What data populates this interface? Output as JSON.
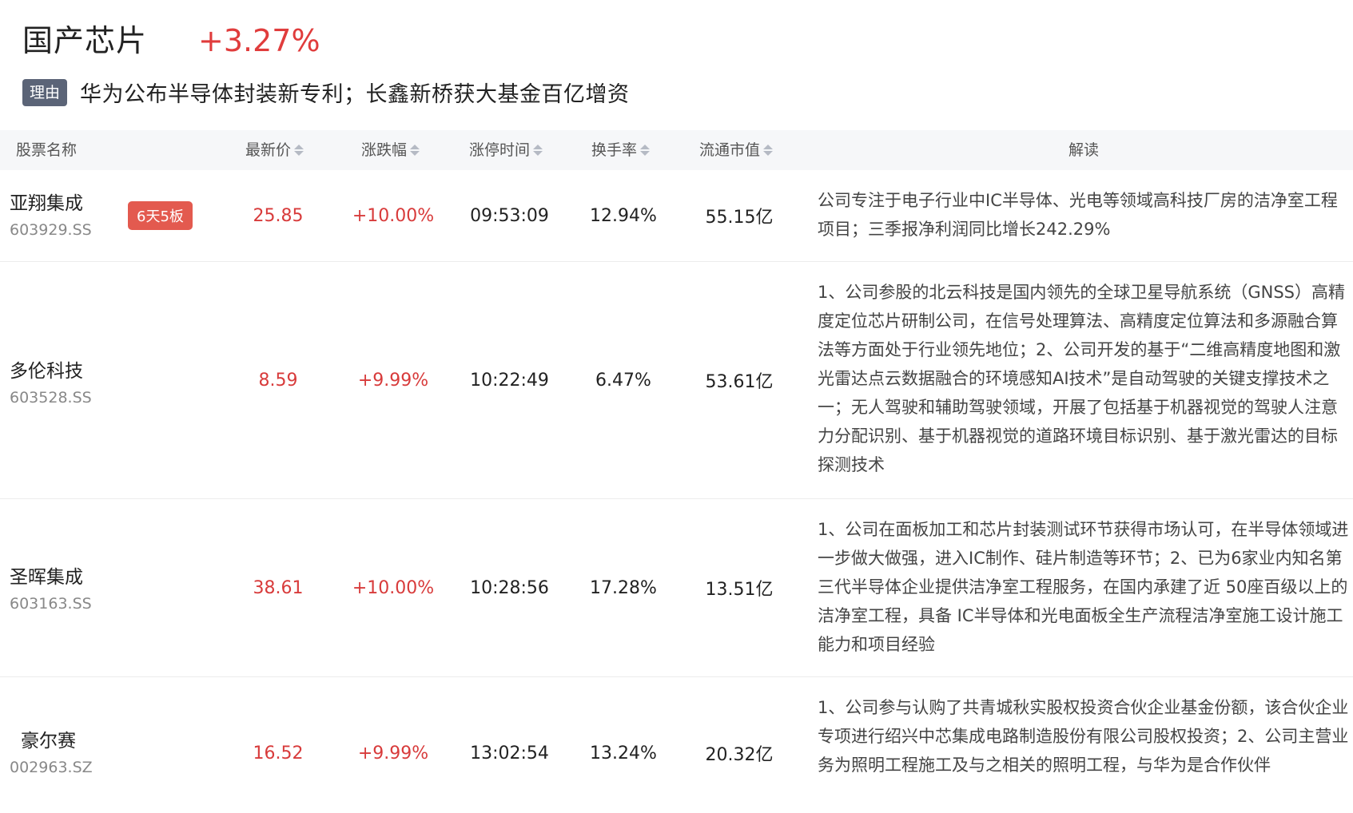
{
  "header": {
    "sector_name": "国产芯片",
    "sector_change": "+3.27%",
    "reason_tag": "理由",
    "reason_text": "华为公布半导体封装新专利；长鑫新桥获大基金百亿增资"
  },
  "table": {
    "columns": {
      "name": "股票名称",
      "price": "最新价",
      "change": "涨跌幅",
      "limit_time": "涨停时间",
      "turnover": "换手率",
      "market_cap": "流通市值",
      "desc": "解读"
    },
    "rows": [
      {
        "name": "亚翔集成",
        "code": "603929.SS",
        "tag": "6天5板",
        "price": "25.85",
        "change": "+10.00%",
        "limit_time": "09:53:09",
        "turnover": "12.94%",
        "market_cap": "55.15亿",
        "desc": "公司专注于电子行业中IC半导体、光电等领域高科技厂房的洁净室工程项目；三季报净利润同比增长242.29%"
      },
      {
        "name": "多伦科技",
        "code": "603528.SS",
        "tag": "",
        "price": "8.59",
        "change": "+9.99%",
        "limit_time": "10:22:49",
        "turnover": "6.47%",
        "market_cap": "53.61亿",
        "desc": "1、公司参股的北云科技是国内领先的全球卫星导航系统（GNSS）高精度定位芯片研制公司，在信号处理算法、高精度定位算法和多源融合算法等方面处于行业领先地位；2、公司开发的基于“二维高精度地图和激光雷达点云数据融合的环境感知AI技术”是自动驾驶的关键支撑技术之一；无人驾驶和辅助驾驶领域，开展了包括基于机器视觉的驾驶人注意力分配识别、基于机器视觉的道路环境目标识别、基于激光雷达的目标探测技术"
      },
      {
        "name": "圣晖集成",
        "code": "603163.SS",
        "tag": "",
        "price": "38.61",
        "change": "+10.00%",
        "limit_time": "10:28:56",
        "turnover": "17.28%",
        "market_cap": "13.51亿",
        "desc": "1、公司在面板加工和芯片封装测试环节获得市场认可，在半导体领域进一步做大做强，进入IC制作、硅片制造等环节；2、已为6家业内知名第三代半导体企业提供洁净室工程服务，在国内承建了近 50座百级以上的洁净室工程，具备 IC半导体和光电面板全生产流程洁净室施工设计施工能力和项目经验"
      },
      {
        "name": "豪尔赛",
        "code": "002963.SZ",
        "tag": "",
        "price": "16.52",
        "change": "+9.99%",
        "limit_time": "13:02:54",
        "turnover": "13.24%",
        "market_cap": "20.32亿",
        "desc": "1、公司参与认购了共青城秋实股权投资合伙企业基金份额，该合伙企业专项进行绍兴中芯集成电路制造股份有限公司股权投资；2、公司主营业务为照明工程施工及与之相关的照明工程，与华为是合作伙伴"
      }
    ]
  }
}
